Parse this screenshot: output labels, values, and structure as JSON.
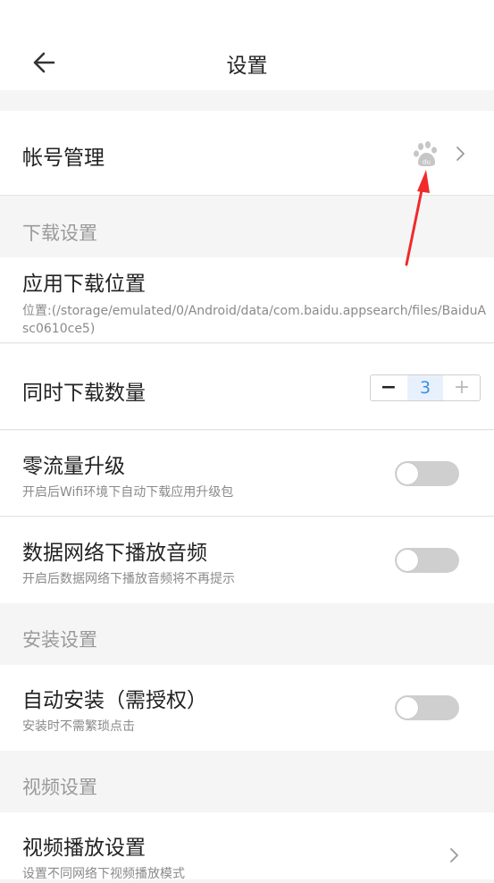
{
  "header": {
    "title": "设置"
  },
  "account": {
    "label": "帐号管理"
  },
  "sections": {
    "download": "下载设置",
    "install": "安装设置",
    "video": "视频设置"
  },
  "download_location": {
    "label": "应用下载位置",
    "path": "位置:(/storage/emulated/0/Android/data/com.baidu.appsearch/files/BaiduAsc0610ce5)"
  },
  "concurrent": {
    "label": "同时下载数量",
    "minus": "−",
    "value": "3",
    "plus": "+"
  },
  "zero_traffic": {
    "label": "零流量升级",
    "desc": "开启后Wifi环境下自动下载应用升级包",
    "enabled": false
  },
  "cellular_audio": {
    "label": "数据网络下播放音频",
    "desc": "开启后数据网络下播放音频将不再提示",
    "enabled": false
  },
  "auto_install": {
    "label": "自动安装（需授权）",
    "desc": "安装时不需繁琐点击",
    "enabled": false
  },
  "video_play": {
    "label": "视频播放设置",
    "desc": "设置不同网络下视频播放模式"
  },
  "icons": {
    "back": "arrow-left-icon",
    "baidu": "baidu-paw-icon",
    "chevron": "chevron-right-icon"
  },
  "colors": {
    "annotation": "#ef2b2b",
    "accent": "#3b8fe6",
    "toggle_off": "#cfcfcf"
  }
}
